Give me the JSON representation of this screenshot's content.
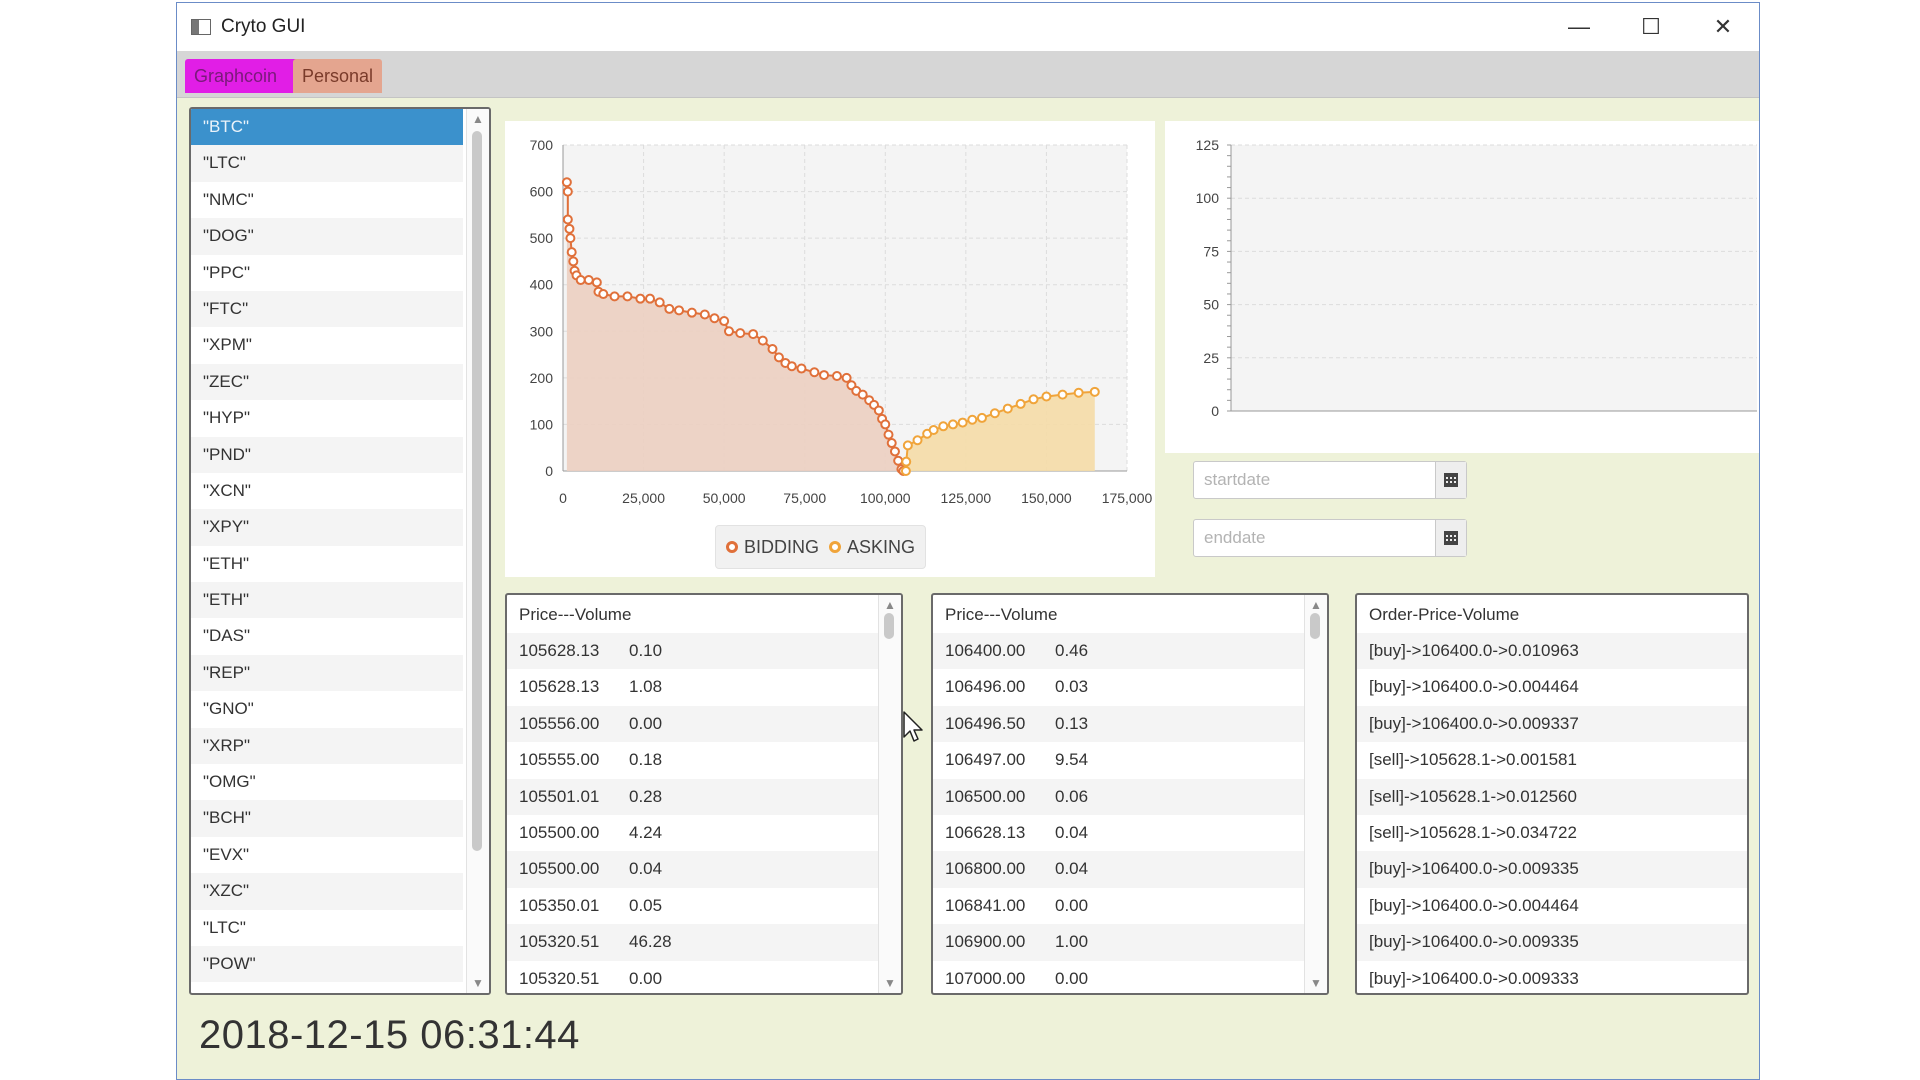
{
  "window": {
    "title": "Cryto GUI",
    "controls": {
      "minimize": "—",
      "maximize": "☐",
      "close": "✕"
    }
  },
  "tabs": [
    {
      "label": "Graphcoin",
      "active": true,
      "color": "#e11ee6"
    },
    {
      "label": "Personal",
      "active": false,
      "color": "#e4a58f"
    }
  ],
  "coins": {
    "selected": "\"BTC\"",
    "items": [
      "\"BTC\"",
      "\"LTC\"",
      "\"NMC\"",
      "\"DOG\"",
      "\"PPC\"",
      "\"FTC\"",
      "\"XPM\"",
      "\"ZEC\"",
      "\"HYP\"",
      "\"PND\"",
      "\"XCN\"",
      "\"XPY\"",
      "\"ETH\"",
      "\"ETH\"",
      "\"DAS\"",
      "\"REP\"",
      "\"GNO\"",
      "\"XRP\"",
      "\"OMG\"",
      "\"BCH\"",
      "\"EVX\"",
      "\"XZC\"",
      "\"LTC\"",
      "\"POW\""
    ]
  },
  "chart_data": [
    {
      "type": "area",
      "title": "",
      "xlabel": "",
      "ylabel": "",
      "xlim": [
        0,
        175000
      ],
      "ylim": [
        0,
        700
      ],
      "x_ticks": [
        "0",
        "25,000",
        "50,000",
        "75,000",
        "100,000",
        "125,000",
        "150,000",
        "175,000"
      ],
      "y_ticks": [
        "0",
        "100",
        "200",
        "300",
        "400",
        "500",
        "600",
        "700"
      ],
      "grid": true,
      "legend_position": "bottom",
      "series": [
        {
          "name": "BIDDING",
          "color": "#e0703a",
          "fill": "#eccfc1",
          "points": [
            [
              1200,
              620
            ],
            [
              1500,
              600
            ],
            [
              1500,
              540
            ],
            [
              2000,
              520
            ],
            [
              2300,
              500
            ],
            [
              2700,
              470
            ],
            [
              3200,
              450
            ],
            [
              3600,
              430
            ],
            [
              4200,
              420
            ],
            [
              5500,
              410
            ],
            [
              8000,
              410
            ],
            [
              10500,
              405
            ],
            [
              11000,
              385
            ],
            [
              12500,
              380
            ],
            [
              16000,
              375
            ],
            [
              20000,
              375
            ],
            [
              24000,
              370
            ],
            [
              27000,
              370
            ],
            [
              30000,
              362
            ],
            [
              33000,
              348
            ],
            [
              36000,
              345
            ],
            [
              40000,
              340
            ],
            [
              44000,
              336
            ],
            [
              47000,
              328
            ],
            [
              50000,
              322
            ],
            [
              51500,
              300
            ],
            [
              55000,
              296
            ],
            [
              59000,
              294
            ],
            [
              62000,
              280
            ],
            [
              65000,
              262
            ],
            [
              67000,
              244
            ],
            [
              69000,
              232
            ],
            [
              71000,
              225
            ],
            [
              74000,
              220
            ],
            [
              78000,
              212
            ],
            [
              81000,
              206
            ],
            [
              85000,
              204
            ],
            [
              88000,
              200
            ],
            [
              89500,
              184
            ],
            [
              91000,
              172
            ],
            [
              93000,
              164
            ],
            [
              95000,
              152
            ],
            [
              96500,
              142
            ],
            [
              98000,
              130
            ],
            [
              99000,
              112
            ],
            [
              100000,
              100
            ],
            [
              101000,
              78
            ],
            [
              102000,
              60
            ],
            [
              103000,
              42
            ],
            [
              104000,
              22
            ],
            [
              105000,
              4
            ],
            [
              105600,
              0
            ]
          ]
        },
        {
          "name": "ASKING",
          "color": "#f0a43a",
          "fill": "#f5dca7",
          "points": [
            [
              106400,
              0
            ],
            [
              106500,
              20
            ],
            [
              107000,
              55
            ],
            [
              110000,
              66
            ],
            [
              113000,
              80
            ],
            [
              115000,
              88
            ],
            [
              118000,
              96
            ],
            [
              121000,
              100
            ],
            [
              124000,
              104
            ],
            [
              127000,
              110
            ],
            [
              130000,
              114
            ],
            [
              134000,
              124
            ],
            [
              138000,
              134
            ],
            [
              142000,
              144
            ],
            [
              146000,
              154
            ],
            [
              150000,
              160
            ],
            [
              155000,
              164
            ],
            [
              160000,
              168
            ],
            [
              165000,
              170
            ]
          ]
        }
      ]
    },
    {
      "type": "line",
      "title": "",
      "xlabel": "",
      "ylabel": "",
      "ylim": [
        0,
        125
      ],
      "y_ticks": [
        "0",
        "25",
        "50",
        "75",
        "100",
        "125"
      ],
      "grid": true,
      "series": []
    }
  ],
  "dates": {
    "start_placeholder": "startdate",
    "end_placeholder": "enddate",
    "calendar_icon": "calendar-icon"
  },
  "bids_table": {
    "header": "Price---Volume",
    "rows": [
      [
        "105628.13",
        "0.10"
      ],
      [
        "105628.13",
        "1.08"
      ],
      [
        "105556.00",
        "0.00"
      ],
      [
        "105555.00",
        "0.18"
      ],
      [
        "105501.01",
        "0.28"
      ],
      [
        "105500.00",
        "4.24"
      ],
      [
        "105500.00",
        "0.04"
      ],
      [
        "105350.01",
        "0.05"
      ],
      [
        "105320.51",
        "46.28"
      ],
      [
        "105320.51",
        "0.00"
      ]
    ]
  },
  "asks_table": {
    "header": "Price---Volume",
    "rows": [
      [
        "106400.00",
        "0.46"
      ],
      [
        "106496.00",
        "0.03"
      ],
      [
        "106496.50",
        "0.13"
      ],
      [
        "106497.00",
        "9.54"
      ],
      [
        "106500.00",
        "0.06"
      ],
      [
        "106628.13",
        "0.04"
      ],
      [
        "106800.00",
        "0.04"
      ],
      [
        "106841.00",
        "0.00"
      ],
      [
        "106900.00",
        "1.00"
      ],
      [
        "107000.00",
        "0.00"
      ]
    ]
  },
  "orders_table": {
    "header": "Order-Price-Volume",
    "rows": [
      "[buy]->106400.0->0.010963",
      "[buy]->106400.0->0.004464",
      "[buy]->106400.0->0.009337",
      "[sell]->105628.1->0.001581",
      "[sell]->105628.1->0.012560",
      "[sell]->105628.1->0.034722",
      "[buy]->106400.0->0.009335",
      "[buy]->106400.0->0.004464",
      "[buy]->106400.0->0.009335",
      "[buy]->106400.0->0.009333"
    ]
  },
  "timestamp": "2018-12-15 06:31:44"
}
